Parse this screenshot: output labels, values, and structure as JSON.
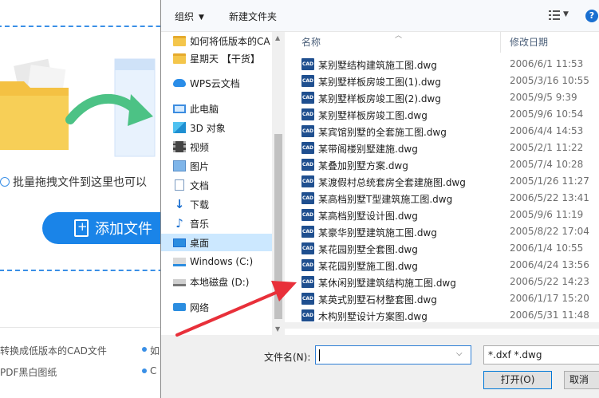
{
  "background_app": {
    "drop_hint": "批量拖拽文件到这里也可以",
    "add_file_label": "添加文件",
    "features": [
      "转换成低版本的CAD文件",
      "PDF黑白图纸",
      "如",
      "C"
    ]
  },
  "toolbar": {
    "organize_label": "组织",
    "organize_caret": "▼",
    "new_folder_label": "新建文件夹",
    "view_caret": "▼",
    "help_label": "?"
  },
  "nav": {
    "items": [
      {
        "label": "如何将低版本的CA",
        "icon": "folder-icon"
      },
      {
        "label": "星期天 【干货】",
        "icon": "folder-icon"
      },
      {
        "label": "WPS云文档",
        "icon": "cloud-icon"
      },
      {
        "label": "此电脑",
        "icon": "computer-icon"
      },
      {
        "label": "3D 对象",
        "icon": "3d-objects-icon"
      },
      {
        "label": "视频",
        "icon": "video-icon"
      },
      {
        "label": "图片",
        "icon": "pictures-icon"
      },
      {
        "label": "文档",
        "icon": "documents-icon"
      },
      {
        "label": "下载",
        "icon": "download-icon"
      },
      {
        "label": "音乐",
        "icon": "music-icon"
      },
      {
        "label": "桌面",
        "icon": "desktop-icon",
        "selected": true
      },
      {
        "label": "Windows (C:)",
        "icon": "windows-drive-icon"
      },
      {
        "label": "本地磁盘 (D:)",
        "icon": "disk-drive-icon"
      },
      {
        "label": "网络",
        "icon": "network-icon"
      }
    ]
  },
  "file_list": {
    "col_name": "名称",
    "col_date": "修改日期",
    "files": [
      {
        "name": "某别墅结构建筑施工图.dwg",
        "date": "2006/6/1 11:53"
      },
      {
        "name": "某别墅样板房竣工图(1).dwg",
        "date": "2005/3/16 10:55"
      },
      {
        "name": "某别墅样板房竣工图(2).dwg",
        "date": "2005/9/5 9:39"
      },
      {
        "name": "某别墅样板房竣工图.dwg",
        "date": "2005/9/6 10:54"
      },
      {
        "name": "某宾馆别墅的全套施工图.dwg",
        "date": "2006/4/4 14:53"
      },
      {
        "name": "某带阁楼别墅建施.dwg",
        "date": "2005/2/1 11:22"
      },
      {
        "name": "某叠加别墅方案.dwg",
        "date": "2005/7/4 10:28"
      },
      {
        "name": "某渡假村总统套房全套建施图.dwg",
        "date": "2005/1/26 11:27"
      },
      {
        "name": "某高档别墅T型建筑施工图.dwg",
        "date": "2006/5/22 13:41"
      },
      {
        "name": "某高档别墅设计图.dwg",
        "date": "2005/9/6 11:19"
      },
      {
        "name": "某豪华别墅建筑施工图.dwg",
        "date": "2005/8/22 17:04"
      },
      {
        "name": "某花园别墅全套图.dwg",
        "date": "2006/1/4 10:55"
      },
      {
        "name": "某花园别墅施工图.dwg",
        "date": "2006/4/24 13:56"
      },
      {
        "name": "某休闲别墅建筑结构施工图.dwg",
        "date": "2006/5/22 14:23"
      },
      {
        "name": "某英式别墅石材整套图.dwg",
        "date": "2006/1/17 15:20"
      },
      {
        "name": "木构别墅设计方案图.dwg",
        "date": "2006/5/31 11:48"
      }
    ],
    "icon_label": "CAD"
  },
  "bottom": {
    "filename_label": "文件名(N):",
    "filename_value": "",
    "filetype_value": "*.dxf *.dwg",
    "open_label": "打开(O)",
    "cancel_label": "取消"
  },
  "colors": {
    "accent": "#1a84e8",
    "selection": "#cce8ff",
    "annotation": "#e8303a"
  }
}
